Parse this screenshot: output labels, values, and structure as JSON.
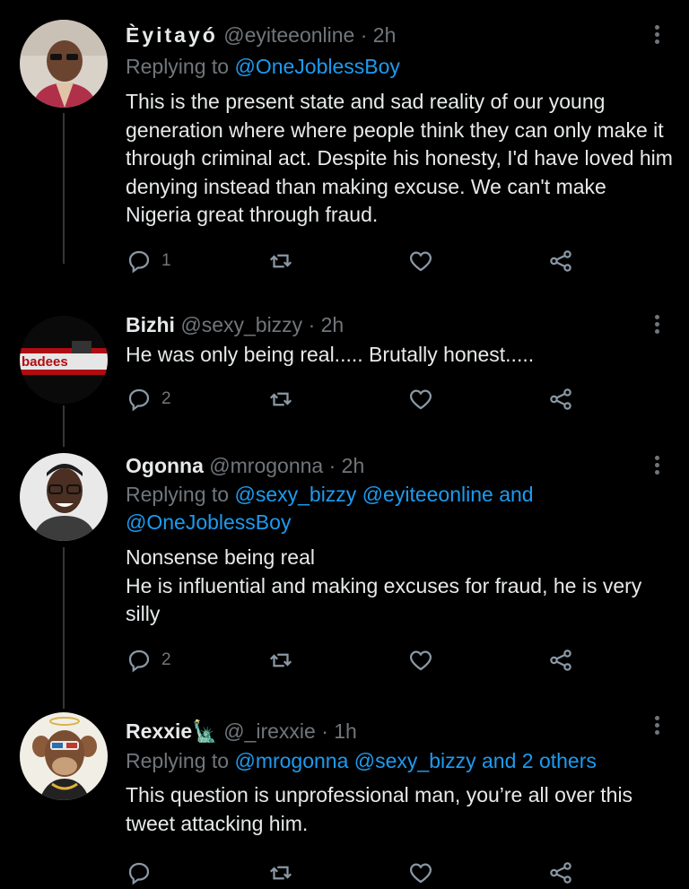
{
  "tweets": [
    {
      "name": "Èyitayó",
      "handle": "@eyiteeonline",
      "time": "2h",
      "replying_prefix": "Replying to",
      "mentions": "@OneJoblessBoy",
      "body": "This is the present state and sad reality of our young generation where where people think they can only make it through criminal act. Despite his honesty, I'd have loved him denying instead than making excuse. We can't make Nigeria great through fraud.",
      "reply_count": "1"
    },
    {
      "name": "Bizhi",
      "handle": "@sexy_bizzy",
      "time": "2h",
      "body": "He was only being real..... Brutally honest.....",
      "reply_count": "2",
      "avatar_text": "badees"
    },
    {
      "name": "Ogonna",
      "handle": "@mrogonna",
      "time": "2h",
      "replying_prefix": "Replying to",
      "mentions": "@sexy_bizzy @eyiteeonline and @OneJoblessBoy",
      "body": "Nonsense being real\nHe is influential and making excuses for fraud, he is very silly",
      "reply_count": "2"
    },
    {
      "name": "Rexxie",
      "name_emoji": "🗽",
      "handle": "@_irexxie",
      "time": "1h",
      "replying_prefix": "Replying to",
      "mentions": "@mrogonna @sexy_bizzy and 2 others",
      "body": "This question is unprofessional man, you’re all over this tweet attacking him.",
      "reply_count": ""
    }
  ],
  "separator": "·",
  "icons": [
    "reply-icon",
    "retweet-icon",
    "like-icon",
    "share-icon",
    "more-icon"
  ],
  "colors": {
    "background": "#000000",
    "text": "#e7e9ea",
    "muted": "#71767b",
    "link": "#1d9bf0"
  }
}
